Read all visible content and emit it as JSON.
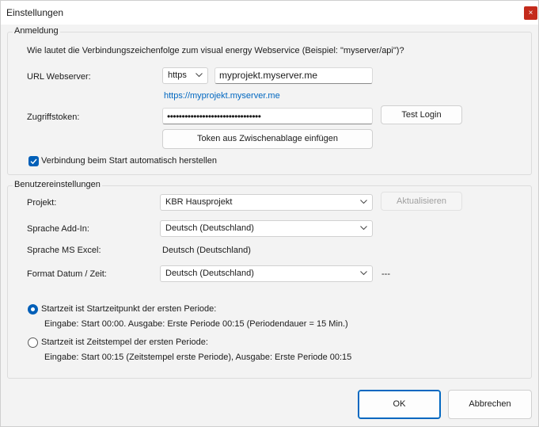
{
  "window": {
    "title": "Einstellungen",
    "close_glyph": "×"
  },
  "login": {
    "group_title": "Anmeldung",
    "question": "Wie lautet die Verbindungszeichenfolge zum visual energy Webservice (Beispiel: \"myserver/api\")?",
    "url_label": "URL Webserver:",
    "protocol_value": "https",
    "server_value": "myprojekt.myserver.me",
    "url_preview": "https://myprojekt.myserver.me",
    "token_label": "Zugriffstoken:",
    "token_masked": "••••••••••••••••••••••••••••••••",
    "test_login_label": "Test Login",
    "paste_token_label": "Token aus Zwischenablage einfügen",
    "autoconnect_label": "Verbindung beim Start automatisch herstellen",
    "autoconnect_checked": true
  },
  "user": {
    "group_title": "Benutzereinstellungen",
    "project_label": "Projekt:",
    "project_value": "KBR Hausprojekt",
    "refresh_label": "Aktualisieren",
    "addin_lang_label": "Sprache Add-In:",
    "addin_lang_value": "Deutsch (Deutschland)",
    "excel_lang_label": "Sprache MS Excel:",
    "excel_lang_value": "Deutsch (Deutschland)",
    "datetime_label": "Format Datum / Zeit:",
    "datetime_value": "Deutsch (Deutschland)",
    "datetime_suffix": "---",
    "option1_label": "Startzeit ist Startzeitpunkt der ersten Periode:",
    "option1_detail": "Eingabe: Start 00:00. Ausgabe: Erste Periode 00:15 (Periodendauer = 15 Min.)",
    "option2_label": "Startzeit ist Zeitstempel der ersten Periode:",
    "option2_detail": "Eingabe: Start 00:15 (Zeitstempel erste Periode), Ausgabe: Erste Periode 00:15",
    "selected_option": 1
  },
  "footer": {
    "ok_label": "OK",
    "cancel_label": "Abbrechen"
  },
  "colors": {
    "accent": "#005fb8",
    "link": "#0067c0",
    "close": "#c42b1c"
  }
}
